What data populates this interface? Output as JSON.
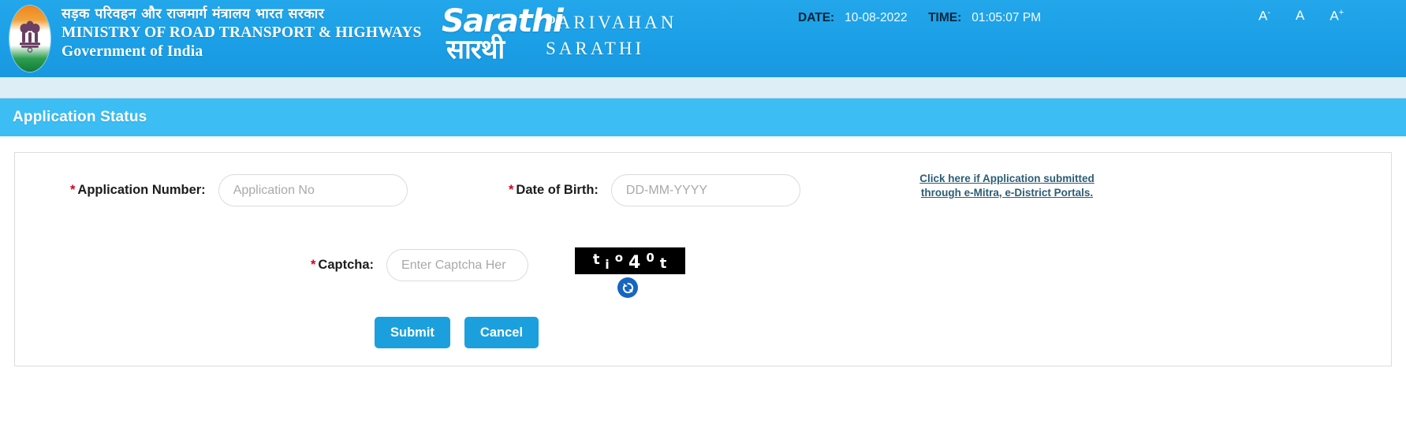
{
  "header": {
    "ministry_hindi": "सड़क परिवहन और राजमार्ग मंत्रालय भारत सरकार",
    "ministry_en_line1": "MINISTRY OF ROAD TRANSPORT & HIGHWAYS",
    "ministry_en_line2": "Government of India",
    "logo_text_en": "Sarathi",
    "logo_text_hi": "सारथी",
    "brand_line1": "PARIVAHAN",
    "brand_line2": "SARATHI",
    "date_label": "DATE:",
    "date_value": "10-08-2022",
    "time_label": "TIME:",
    "time_value": "01:05:07 PM",
    "font_decrease": "A",
    "font_decrease_sup": "-",
    "font_normal": "A",
    "font_increase": "A",
    "font_increase_sup": "+",
    "bg_color": "#1ba1e8"
  },
  "page": {
    "title": "Application Status",
    "title_bar_color": "#3cbdf4"
  },
  "form": {
    "required_mark": "*",
    "application_number": {
      "label": "Application Number:",
      "placeholder": "Application No",
      "value": ""
    },
    "date_of_birth": {
      "label": "Date of Birth:",
      "placeholder": "DD-MM-YYYY",
      "value": ""
    },
    "captcha": {
      "label": "Captcha:",
      "placeholder": "Enter Captcha Her",
      "value": "",
      "image_text": "tio40t",
      "chars": [
        "t",
        "i",
        "o",
        "4",
        "0",
        "t"
      ],
      "refresh_icon": "refresh-icon"
    },
    "emitra_link": "Click here if Application submitted through e-Mitra, e-District Portals.",
    "submit_label": "Submit",
    "cancel_label": "Cancel",
    "button_color": "#1ba0dd"
  }
}
